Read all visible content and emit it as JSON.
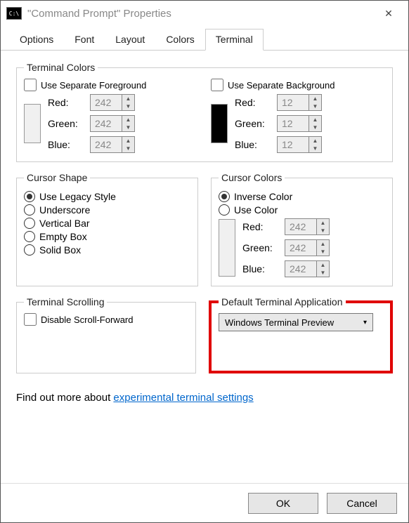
{
  "window": {
    "title": "\"Command Prompt\" Properties"
  },
  "tabs": [
    "Options",
    "Font",
    "Layout",
    "Colors",
    "Terminal"
  ],
  "activeTab": "Terminal",
  "termColors": {
    "legend": "Terminal Colors",
    "fgCheck": "Use Separate Foreground",
    "bgCheck": "Use Separate Background",
    "labels": {
      "red": "Red:",
      "green": "Green:",
      "blue": "Blue:"
    },
    "fg": {
      "r": "242",
      "g": "242",
      "b": "242"
    },
    "bg": {
      "r": "12",
      "g": "12",
      "b": "12"
    }
  },
  "cursorShape": {
    "legend": "Cursor Shape",
    "options": [
      "Use Legacy Style",
      "Underscore",
      "Vertical Bar",
      "Empty Box",
      "Solid Box"
    ],
    "selected": 0
  },
  "cursorColors": {
    "legend": "Cursor Colors",
    "inverse": "Inverse Color",
    "useColor": "Use Color",
    "selected": "inverse",
    "labels": {
      "red": "Red:",
      "green": "Green:",
      "blue": "Blue:"
    },
    "vals": {
      "r": "242",
      "g": "242",
      "b": "242"
    }
  },
  "scrolling": {
    "legend": "Terminal Scrolling",
    "disable": "Disable Scroll-Forward"
  },
  "defaultApp": {
    "legend": "Default Terminal Application",
    "selected": "Windows Terminal Preview"
  },
  "link": {
    "prefix": "Find out more about ",
    "text": "experimental terminal settings"
  },
  "buttons": {
    "ok": "OK",
    "cancel": "Cancel"
  }
}
